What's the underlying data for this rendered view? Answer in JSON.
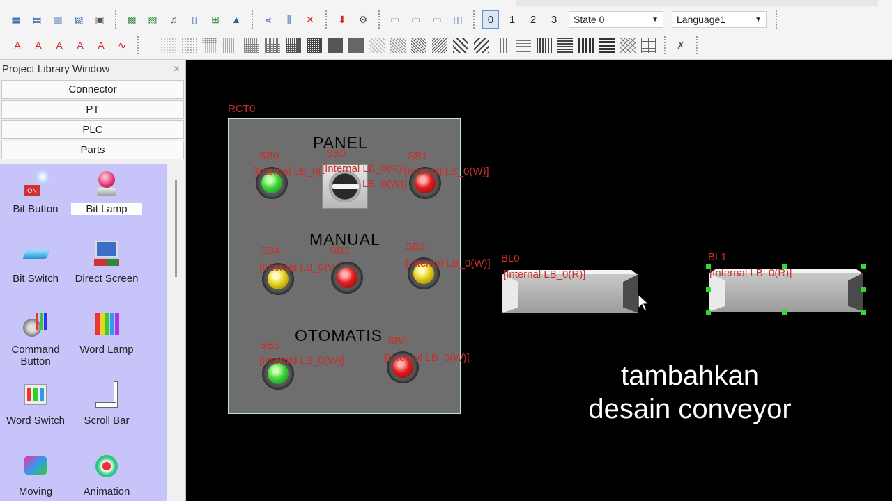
{
  "toolbar": {
    "states": [
      "0",
      "1",
      "2",
      "3"
    ],
    "active_state": "0",
    "state_dropdown": "State 0",
    "language_dropdown": "Language1"
  },
  "sidebar": {
    "title": "Project Library Window",
    "close": "×",
    "categories": [
      "Connector",
      "PT",
      "PLC",
      "Parts"
    ],
    "parts": [
      {
        "label": "Bit Button"
      },
      {
        "label": "Bit Lamp"
      },
      {
        "label": "Bit Switch"
      },
      {
        "label": "Direct Screen"
      },
      {
        "label": "Command Button"
      },
      {
        "label": "Word Lamp"
      },
      {
        "label": "Word Switch"
      },
      {
        "label": "Scroll Bar"
      },
      {
        "label": "Moving"
      },
      {
        "label": "Animation"
      }
    ]
  },
  "canvas": {
    "rect_tag": "RCT0",
    "sections": [
      "PANEL",
      "MANUAL",
      "OTOMATIS"
    ],
    "lamp_tags": {
      "sb0": "SB0",
      "sb0_addr": "[Internal LB_0(R)]",
      "sb1": "SB1",
      "sb1_addr": "[Internal LB_0(W)]",
      "sel": "SS0",
      "sel_addr": "[Internal LB_0(R)]",
      "sel_addr2": "LB_0(W)]",
      "sb4": "SB4",
      "sb4_addr": "[Internal LB_0(W)]",
      "sb3": "SB3",
      "sb3_addr": "[Internal LB_0(W)]",
      "sb2": "SB2",
      "sb2_addr": "[Internal LB_0(W)]",
      "sb5": "SB5",
      "sb5_addr": "[Internal LB_0(W)]",
      "sb6": "SB6",
      "sb6_addr": "[Internal LB_0(W)]"
    },
    "conveyors": [
      {
        "tag": "BL0",
        "addr": "[Internal LB_0(R)]"
      },
      {
        "tag": "BL1",
        "addr": "[Internal LB_0(R)]"
      }
    ]
  },
  "caption": {
    "line1": "tambahkan",
    "line2": "desain conveyor"
  }
}
